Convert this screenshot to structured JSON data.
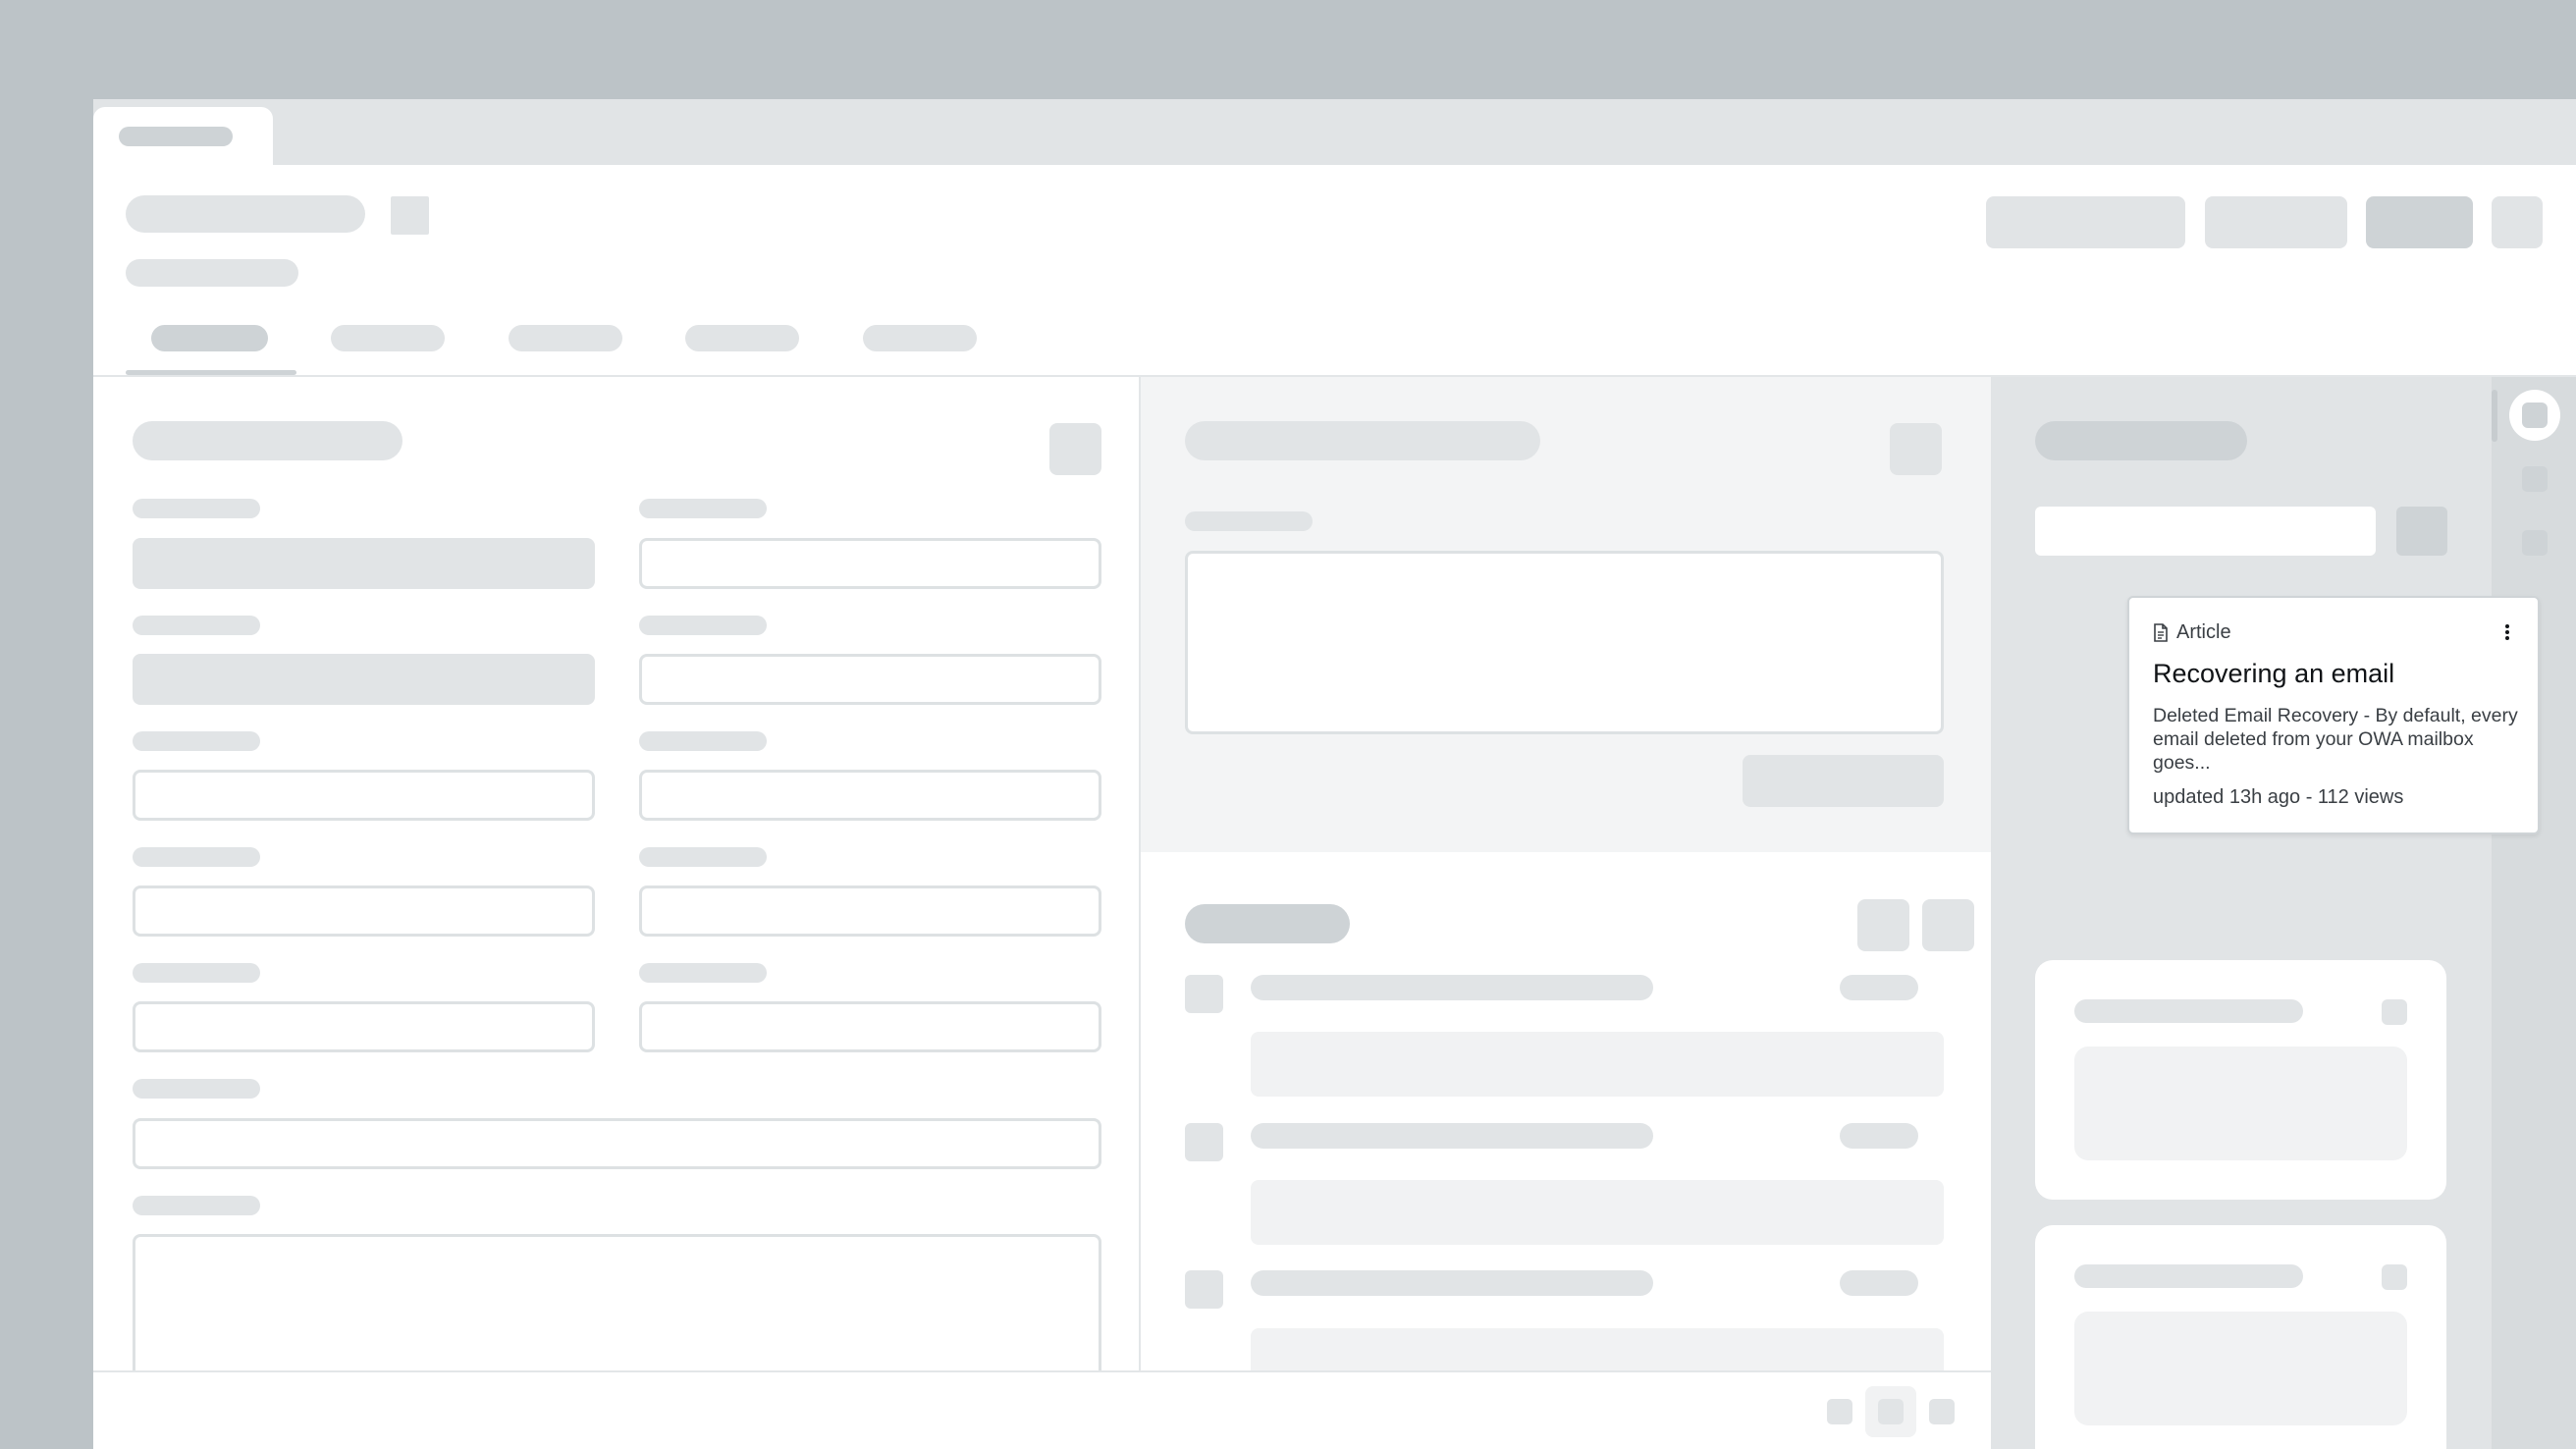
{
  "article_card": {
    "type_label": "Article",
    "title": "Recovering an email",
    "description": "Deleted Email Recovery - By default, every email deleted from your OWA mailbox goes...",
    "meta": "updated 13h ago - 112 views"
  },
  "icons": {
    "article": "document-icon",
    "menu": "kebab-menu-icon"
  },
  "colors": {
    "frame": "#bcc3c7",
    "skeleton": "#e1e4e6",
    "pane_gray": "#f3f4f5"
  }
}
